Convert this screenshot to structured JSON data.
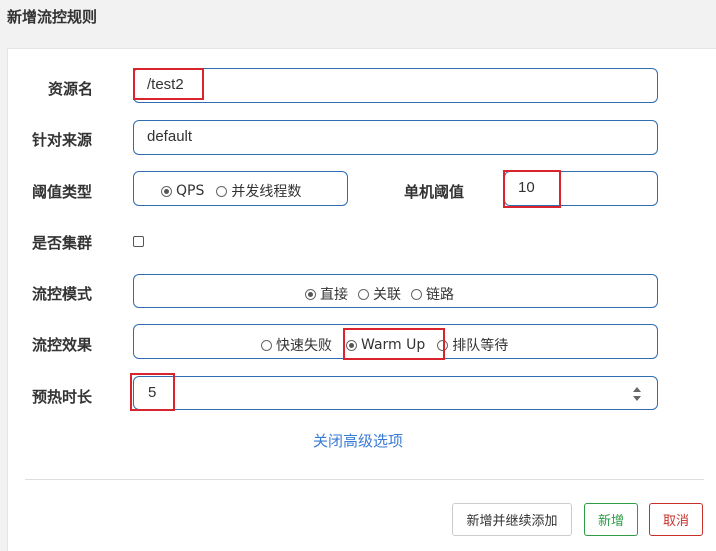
{
  "dialog": {
    "title": "新增流控规则"
  },
  "form": {
    "resource_label": "资源名",
    "resource_value": "/test2",
    "origin_label": "针对来源",
    "origin_value": "default",
    "threshold_type_label": "阈值类型",
    "threshold_type_options": [
      "QPS",
      "并发线程数"
    ],
    "threshold_type_selected": "QPS",
    "single_threshold_label": "单机阈值",
    "single_threshold_value": "10",
    "cluster_label": "是否集群",
    "cluster_checked": false,
    "mode_label": "流控模式",
    "mode_options": [
      "直接",
      "关联",
      "链路"
    ],
    "mode_selected": "直接",
    "effect_label": "流控效果",
    "effect_options": [
      "快速失败",
      "Warm Up",
      "排队等待"
    ],
    "effect_selected": "Warm Up",
    "warmup_label": "预热时长",
    "warmup_value": "5",
    "advanced_link": "关闭高级选项"
  },
  "footer": {
    "add_continue_label": "新增并继续添加",
    "add_label": "新增",
    "cancel_label": "取消"
  },
  "colors": {
    "field_border": "#2f6db0",
    "highlight": "#d9232d",
    "link": "#3a7bd5",
    "add_green": "#2e9b45",
    "cancel_red": "#c9302c"
  }
}
